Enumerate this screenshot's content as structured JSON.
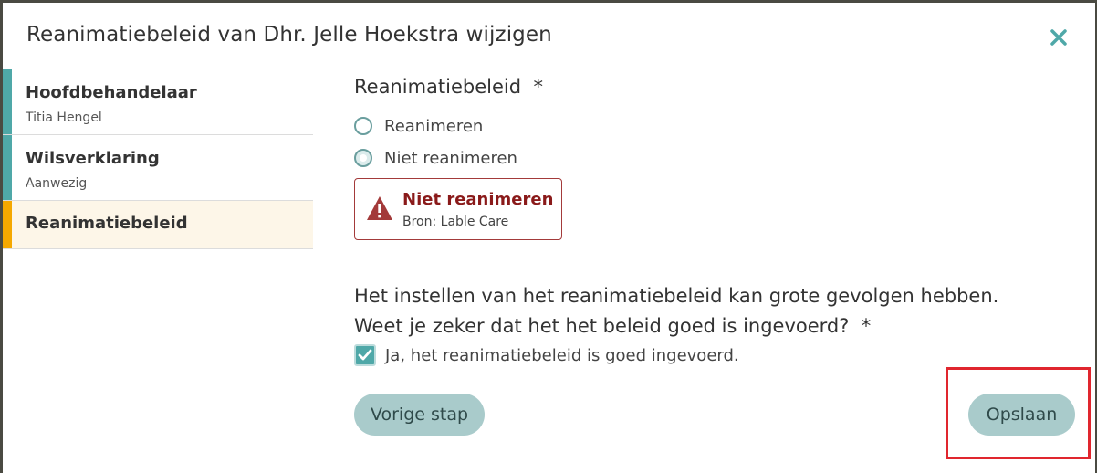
{
  "dialog": {
    "title": "Reanimatiebeleid van Dhr. Jelle Hoekstra wijzigen",
    "close_icon": "close-icon"
  },
  "sidebar": {
    "steps": [
      {
        "title": "Hoofdbehandelaar",
        "subtitle": "Titia Hengel",
        "color": "#4fa8a8",
        "state": "complete"
      },
      {
        "title": "Wilsverklaring",
        "subtitle": "Aanwezig",
        "color": "#4fa8a8",
        "state": "complete"
      },
      {
        "title": "Reanimatiebeleid",
        "subtitle": "",
        "color": "#f5a800",
        "state": "active"
      }
    ]
  },
  "form": {
    "field_label": "Reanimatiebeleid",
    "required_marker": "*",
    "options": [
      {
        "label": "Reanimeren",
        "selected": false
      },
      {
        "label": "Niet reanimeren",
        "selected": true
      }
    ],
    "alert": {
      "icon": "warning-icon",
      "title": "Niet reanimeren",
      "source": "Bron: Lable Care",
      "color": "#8a1a1a"
    },
    "question_line1": "Het instellen van het reanimatiebeleid kan grote gevolgen hebben.",
    "question_line2": "Weet je zeker dat het het beleid goed is ingevoerd?",
    "question_required": "*",
    "confirm_label": "Ja, het reanimatiebeleid is goed ingevoerd.",
    "confirm_checked": true
  },
  "buttons": {
    "prev_label": "Vorige stap",
    "save_label": "Opslaan"
  },
  "colors": {
    "accent": "#4fa8a8",
    "button_bg": "#a9cbcb",
    "highlight": "#e0262e"
  }
}
